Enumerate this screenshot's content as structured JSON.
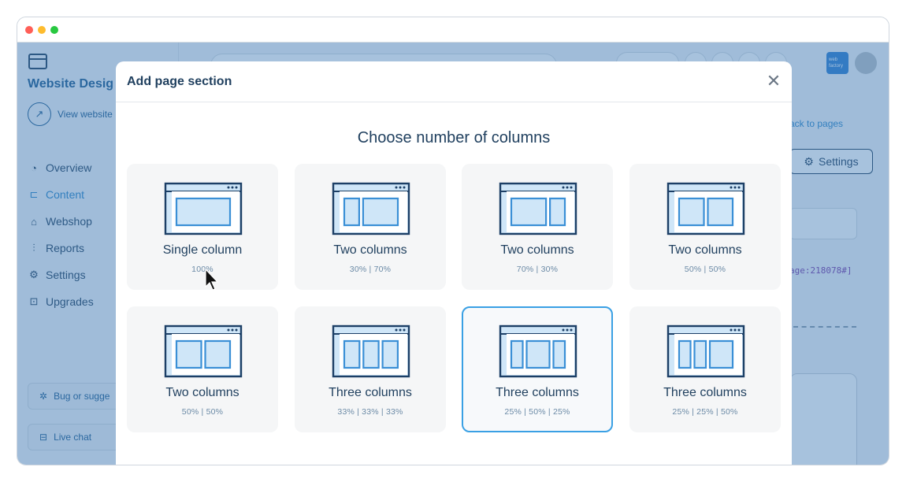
{
  "sidebar": {
    "site_name": "Website Desig",
    "view_website": "View website",
    "nav": [
      {
        "label": "Overview",
        "icon": "speedometer-icon"
      },
      {
        "label": "Content",
        "icon": "content-tree-icon"
      },
      {
        "label": "Webshop",
        "icon": "basket-icon"
      },
      {
        "label": "Reports",
        "icon": "chart-icon"
      },
      {
        "label": "Settings",
        "icon": "gear-icon"
      },
      {
        "label": "Upgrades",
        "icon": "upgrade-icon"
      }
    ],
    "bug_button": "Bug or sugge",
    "chat_button": "Live chat"
  },
  "topbar": {
    "brand_badge": "web factory"
  },
  "main": {
    "back_link": "ack to pages",
    "settings_label": "Settings",
    "code_text": "age:218078#]"
  },
  "modal": {
    "title": "Add page section",
    "close_icon": "close-icon",
    "heading": "Choose number of columns",
    "options": [
      {
        "label": "Single column",
        "sub": "100%",
        "cols": [
          1
        ],
        "selected": false
      },
      {
        "label": "Two columns",
        "sub": "30% | 70%",
        "cols": [
          0.3,
          0.7
        ],
        "selected": false
      },
      {
        "label": "Two columns",
        "sub": "70% | 30%",
        "cols": [
          0.7,
          0.3
        ],
        "selected": false
      },
      {
        "label": "Two columns",
        "sub": "50% | 50%",
        "cols": [
          0.5,
          0.5
        ],
        "selected": false
      },
      {
        "label": "Two columns",
        "sub": "50% | 50%",
        "cols": [
          0.5,
          0.5
        ],
        "selected": false
      },
      {
        "label": "Three columns",
        "sub": "33% | 33% | 33%",
        "cols": [
          0.333,
          0.333,
          0.333
        ],
        "selected": false
      },
      {
        "label": "Three columns",
        "sub": "25% | 50% | 25%",
        "cols": [
          0.25,
          0.5,
          0.25
        ],
        "selected": true
      },
      {
        "label": "Three columns",
        "sub": "25% | 25% | 50%",
        "cols": [
          0.25,
          0.25,
          0.5
        ],
        "selected": false
      }
    ]
  },
  "colors": {
    "overlay": "#3c78b4",
    "accent": "#3aa0e4",
    "text_dark": "#1f3f5e",
    "illus_fill": "#cfe6f8",
    "illus_stroke": "#1c3f66"
  }
}
